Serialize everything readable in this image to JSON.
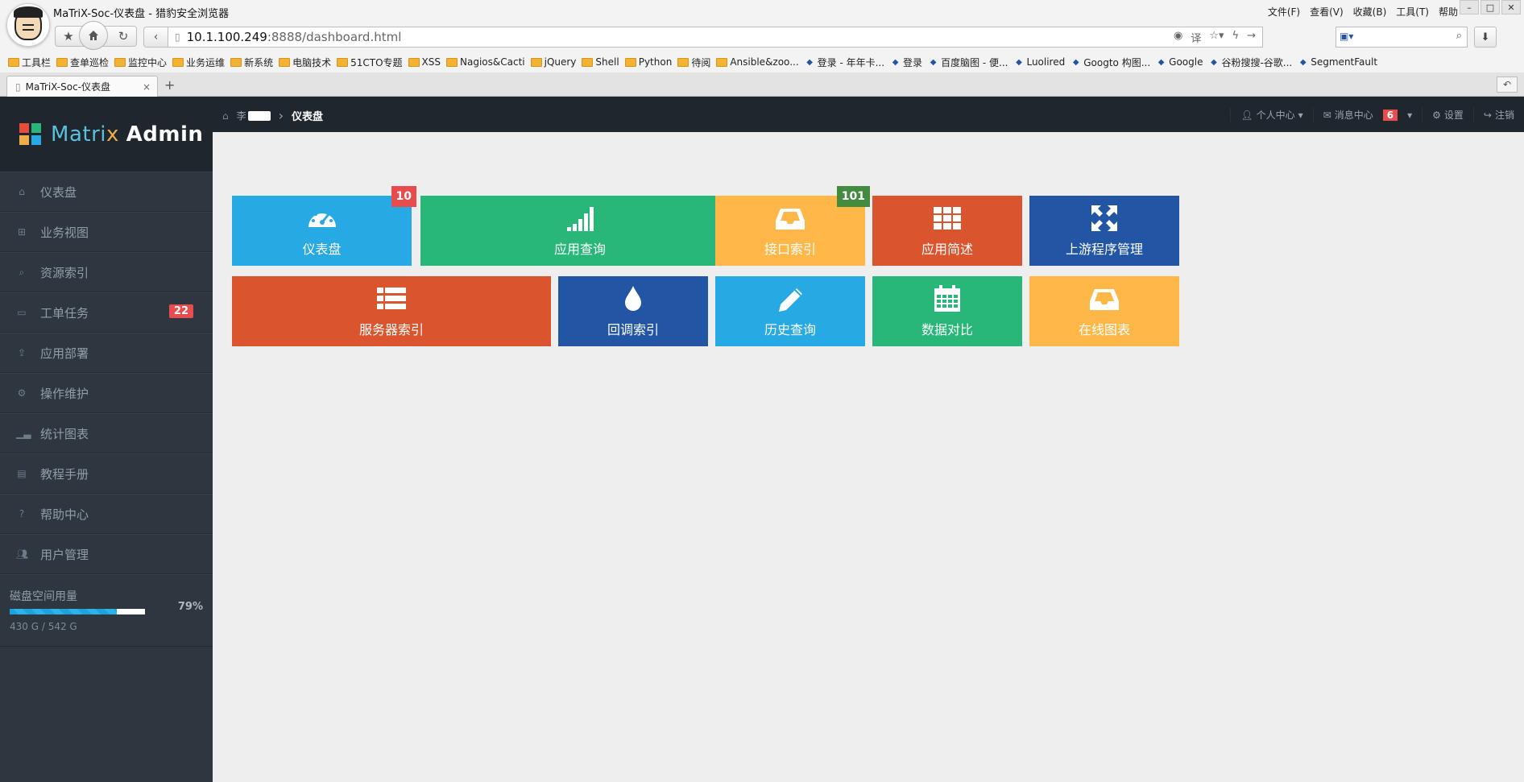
{
  "browser": {
    "window_title": "MaTriX-Soc-仪表盘 - 猎豹安全浏览器",
    "menu": [
      "文件(F)",
      "查看(V)",
      "收藏(B)",
      "工具(T)",
      "帮助"
    ],
    "url_host": "10.1.100.249",
    "url_path": ":8888/dashboard.html",
    "tab_title": "MaTriX-Soc-仪表盘",
    "bookmarks": [
      {
        "label": "工具栏",
        "icon": "folder"
      },
      {
        "label": "查单巡检",
        "icon": "folder"
      },
      {
        "label": "监控中心",
        "icon": "folder"
      },
      {
        "label": "业务运维",
        "icon": "folder"
      },
      {
        "label": "新系统",
        "icon": "folder"
      },
      {
        "label": "电脑技术",
        "icon": "folder"
      },
      {
        "label": "51CTO专题",
        "icon": "folder"
      },
      {
        "label": "XSS",
        "icon": "folder"
      },
      {
        "label": "Nagios&Cacti",
        "icon": "folder"
      },
      {
        "label": "jQuery",
        "icon": "folder"
      },
      {
        "label": "Shell",
        "icon": "folder"
      },
      {
        "label": "Python",
        "icon": "folder"
      },
      {
        "label": "待阅",
        "icon": "folder"
      },
      {
        "label": "Ansible&zoo...",
        "icon": "folder"
      },
      {
        "label": "登录 - 年年卡...",
        "icon": "site"
      },
      {
        "label": "登录",
        "icon": "site"
      },
      {
        "label": "百度脑图 - 便...",
        "icon": "site"
      },
      {
        "label": "Luolired",
        "icon": "site"
      },
      {
        "label": "Googto 构图...",
        "icon": "site"
      },
      {
        "label": "Google",
        "icon": "site"
      },
      {
        "label": "谷粉搜搜-谷歌...",
        "icon": "site"
      },
      {
        "label": "SegmentFault",
        "icon": "site"
      }
    ]
  },
  "app": {
    "brand": {
      "part1": "M",
      "part2": "atri",
      "part3": "x",
      "part4": "Admin"
    },
    "sidebar": {
      "items": [
        {
          "label": "仪表盘",
          "icon": "home-icon"
        },
        {
          "label": "业务视图",
          "icon": "sitemap-icon"
        },
        {
          "label": "资源索引",
          "icon": "search-icon"
        },
        {
          "label": "工单任务",
          "icon": "inbox-icon",
          "badge": "22"
        },
        {
          "label": "应用部署",
          "icon": "upload-icon"
        },
        {
          "label": "操作维护",
          "icon": "cogs-icon"
        },
        {
          "label": "统计图表",
          "icon": "signal-icon"
        },
        {
          "label": "教程手册",
          "icon": "book-icon"
        },
        {
          "label": "帮助中心",
          "icon": "question-icon"
        },
        {
          "label": "用户管理",
          "icon": "users-icon"
        }
      ],
      "disk": {
        "label": "磁盘空间用量",
        "percent": "79%",
        "fraction": 0.79,
        "size": "430 G / 542 G"
      }
    },
    "topbar": {
      "user_prefix": "李",
      "current": "仪表盘",
      "profile": "个人中心",
      "messages": "消息中心",
      "messages_count": "6",
      "settings": "设置",
      "logout": "注销"
    },
    "tiles": [
      {
        "label": "仪表盘",
        "icon": "dashboard-icon",
        "color": "#27a9e3",
        "badge": "10",
        "badge_color": "#e84c4c"
      },
      {
        "label": "应用查询",
        "icon": "signal-icon",
        "color": "#28b779"
      },
      {
        "label": "接口索引",
        "icon": "inbox-icon",
        "color": "#ffb848",
        "badge": "101",
        "badge_color": "#438b3f"
      },
      {
        "label": "应用简述",
        "icon": "th-icon",
        "color": "#da542e"
      },
      {
        "label": "上游程序管理",
        "icon": "fullscreen-icon",
        "color": "#2255a4"
      },
      {
        "label": "服务器索引",
        "icon": "list-icon",
        "color": "#da542e"
      },
      {
        "label": "回调索引",
        "icon": "tint-icon",
        "color": "#2255a4"
      },
      {
        "label": "历史查询",
        "icon": "pencil-icon",
        "color": "#27a9e3"
      },
      {
        "label": "数据对比",
        "icon": "calendar-icon",
        "color": "#28b779"
      },
      {
        "label": "在线图表",
        "icon": "inbox-icon",
        "color": "#ffb848"
      }
    ]
  }
}
